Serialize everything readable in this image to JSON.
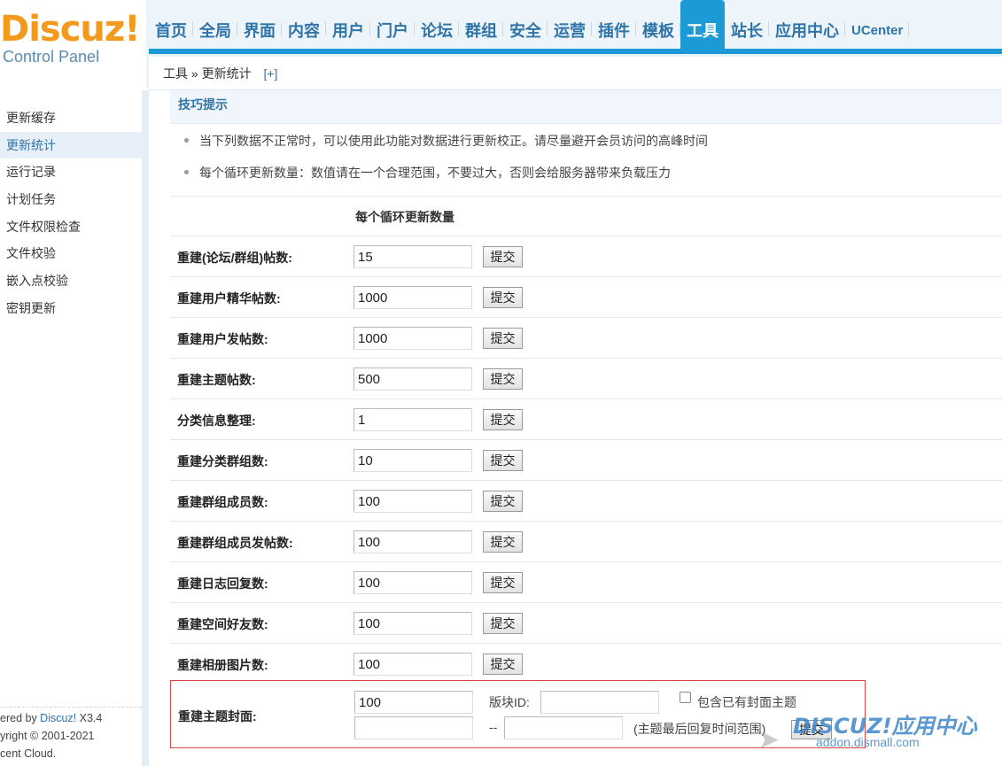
{
  "header": {
    "logo_text": "Discuz!",
    "logo_sub": "Control Panel",
    "nav": [
      "首页",
      "全局",
      "界面",
      "内容",
      "用户",
      "门户",
      "论坛",
      "群组",
      "安全",
      "运营",
      "插件",
      "模板",
      "工具",
      "站长",
      "应用中心",
      "UCenter"
    ],
    "active_nav": "工具"
  },
  "breadcrumb": {
    "section": "工具",
    "separator": "»",
    "page": "更新统计",
    "add": "[+]"
  },
  "sidebar": {
    "items": [
      "更新缓存",
      "更新统计",
      "运行记录",
      "计划任务",
      "文件权限检查",
      "文件校验",
      "嵌入点校验",
      "密钥更新"
    ],
    "active": "更新统计",
    "footer": {
      "powered_prefix": "ered by ",
      "powered_link": "Discuz!",
      "version": " X3.4",
      "copyright": "yright © 2001-2021",
      "company": "cent Cloud."
    }
  },
  "tips": {
    "title": "技巧提示",
    "items": [
      "当下列数据不正常时，可以使用此功能对数据进行更新校正。请尽量避开会员访问的高峰时间",
      "每个循环更新数量：数值请在一个合理范围，不要过大，否则会给服务器带来负载压力"
    ]
  },
  "form": {
    "column_header": "每个循环更新数量",
    "submit_label": "提交",
    "rows": [
      {
        "label": "重建(论坛/群组)帖数:",
        "value": "15"
      },
      {
        "label": "重建用户精华帖数:",
        "value": "1000"
      },
      {
        "label": "重建用户发帖数:",
        "value": "1000"
      },
      {
        "label": "重建主题帖数:",
        "value": "500"
      },
      {
        "label": "分类信息整理:",
        "value": "1"
      },
      {
        "label": "重建分类群组数:",
        "value": "10"
      },
      {
        "label": "重建群组成员数:",
        "value": "100"
      },
      {
        "label": "重建群组成员发帖数:",
        "value": "100"
      },
      {
        "label": "重建日志回复数:",
        "value": "100"
      },
      {
        "label": "重建空间好友数:",
        "value": "100"
      },
      {
        "label": "重建相册图片数:",
        "value": "100"
      }
    ],
    "cover": {
      "label": "重建主题封面:",
      "value": "100",
      "block_id_label": "版块ID:",
      "include_label": "包含已有封面主题",
      "range_sep": "--",
      "range_note": "(主题最后回复时间范围)",
      "submit_label": "提交"
    }
  },
  "watermark": {
    "brand": "DISCUZ!应用中心",
    "site": "addon.dismall.com"
  },
  "colors": {
    "accent": "#1c9ad6",
    "link": "#2f74a8",
    "logo": "#f39a1e",
    "highlight_border": "#dd4444"
  }
}
